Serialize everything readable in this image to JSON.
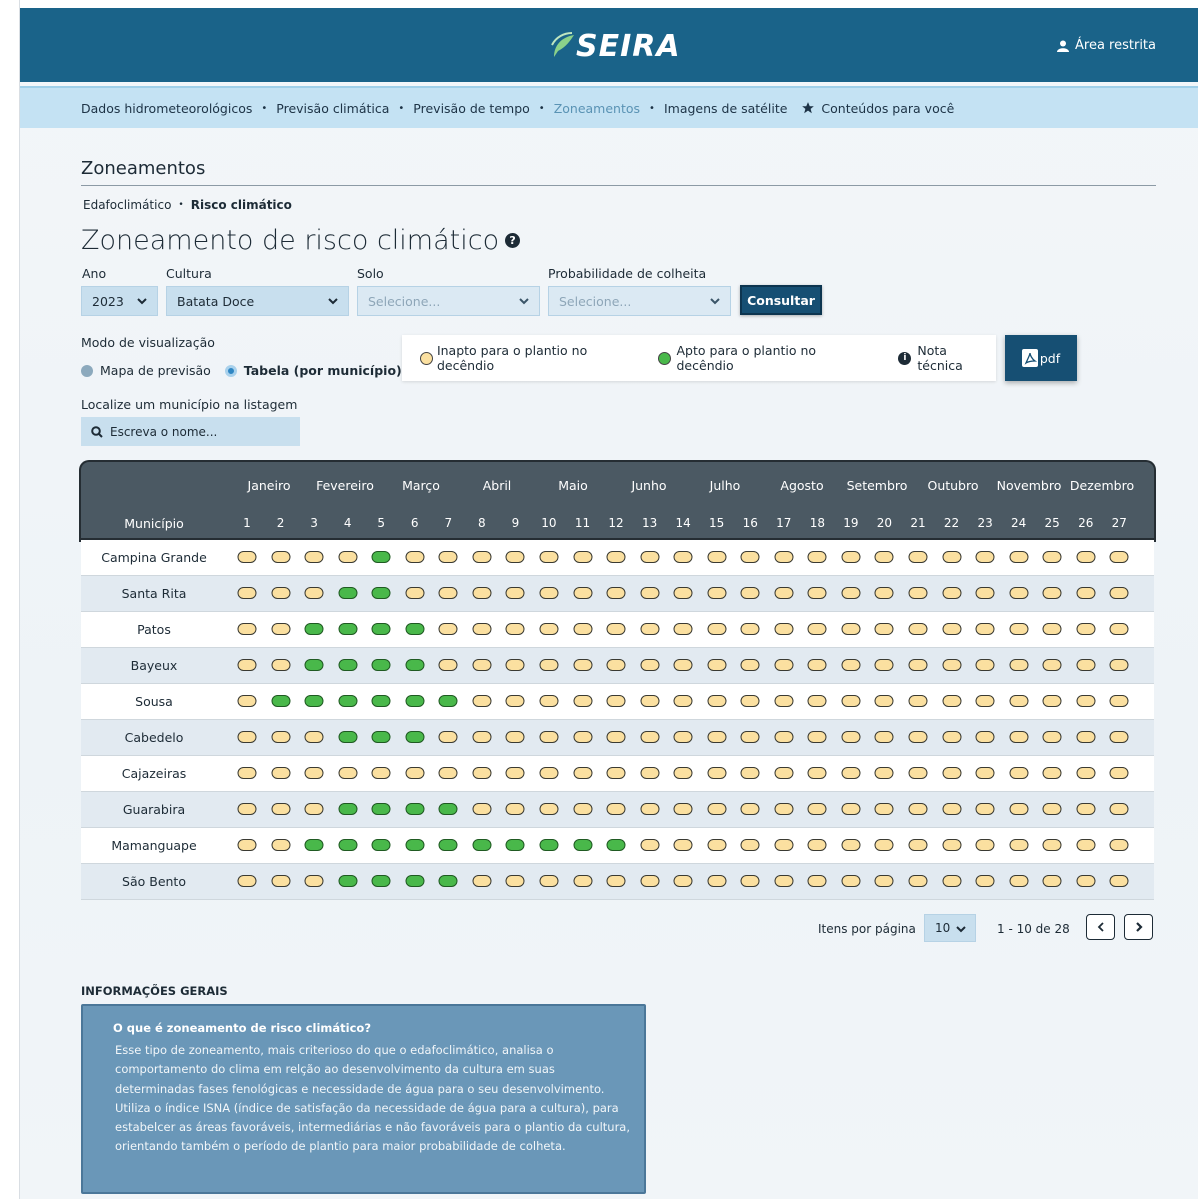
{
  "header": {
    "logo_text": "SEIRA",
    "login_label": "Área restrita"
  },
  "nav": {
    "items": [
      {
        "label": "Dados hidrometeorológicos",
        "active": false
      },
      {
        "label": "Previsão climática",
        "active": false
      },
      {
        "label": "Previsão de tempo",
        "active": false
      },
      {
        "label": "Zoneamentos",
        "active": true
      },
      {
        "label": "Imagens de satélite",
        "active": false
      },
      {
        "label": "Conteúdos para você",
        "active": false,
        "icon": "star-icon"
      }
    ]
  },
  "section_title": "Zoneamentos",
  "breadcrumb": {
    "first": "Edafoclimático",
    "current": "Risco climático"
  },
  "page_title": "Zoneamento de risco climático",
  "filters": {
    "ano_label": "Ano",
    "ano_value": "2023",
    "cultura_label": "Cultura",
    "cultura_value": "Batata Doce",
    "solo_label": "Solo",
    "solo_placeholder": "Selecione...",
    "prob_label": "Probabilidade de colheita",
    "prob_placeholder": "Selecione...",
    "consultar_label": "Consultar"
  },
  "view_mode": {
    "label": "Modo de visualização",
    "option_map": "Mapa de previsão",
    "option_table": "Tabela (por município)",
    "selected": "table"
  },
  "legend": {
    "inapto": "Inapto para o plantio no decêndio",
    "apto": "Apto para o plantio no decêndio",
    "nota": "Nota técnica",
    "colors": {
      "inapto": "#fbe0a0",
      "apto": "#49b84a"
    }
  },
  "pdf_label": "pdf",
  "search": {
    "label": "Localize um município na listagem",
    "placeholder": "Escreva  o nome..."
  },
  "table": {
    "municipio_header": "Município",
    "months": [
      "Janeiro",
      "Fevereiro",
      "Março",
      "Abril",
      "Maio",
      "Junho",
      "Julho",
      "Agosto",
      "Setembro",
      "Outubro",
      "Novembro",
      "Dezembro"
    ],
    "decendios": [
      "1",
      "2",
      "3",
      "4",
      "5",
      "6",
      "7",
      "8",
      "9",
      "10",
      "11",
      "12",
      "13",
      "14",
      "15",
      "16",
      "17",
      "18",
      "19",
      "20",
      "21",
      "22",
      "23",
      "24",
      "25",
      "26",
      "27"
    ],
    "rows": [
      {
        "name": "Campina Grande",
        "apto": [
          5
        ]
      },
      {
        "name": "Santa Rita",
        "apto": [
          4,
          5
        ]
      },
      {
        "name": "Patos",
        "apto": [
          3,
          4,
          5,
          6
        ]
      },
      {
        "name": "Bayeux",
        "apto": [
          3,
          4,
          5,
          6
        ]
      },
      {
        "name": "Sousa",
        "apto": [
          2,
          3,
          4,
          5,
          6,
          7
        ]
      },
      {
        "name": "Cabedelo",
        "apto": [
          4,
          5,
          6
        ]
      },
      {
        "name": "Cajazeiras",
        "apto": []
      },
      {
        "name": "Guarabira",
        "apto": [
          4,
          5,
          6,
          7
        ]
      },
      {
        "name": "Mamanguape",
        "apto": [
          3,
          4,
          5,
          6,
          7,
          8,
          9,
          10,
          11,
          12
        ]
      },
      {
        "name": "São Bento",
        "apto": [
          4,
          5,
          6,
          7
        ]
      }
    ]
  },
  "pagination": {
    "label": "Itens por página",
    "per_page": "10",
    "range": "1 - 10 de 28"
  },
  "info": {
    "title": "INFORMAÇÕES GERAIS",
    "question": "O que é zoneamento de risco climático?",
    "answer": "Esse tipo de zoneamento, mais criterioso do que o edafoclimático, analisa o comportamento do clima em relção ao desenvolvimento da cultura em suas determinadas fases fenológicas e necessidade de água para o seu desenvolvimento. Utiliza o índice ISNA (índice de satisfação da necessidade de água para a cultura), para estabelcer as áreas favoráveis, intermediárias e não favoráveis para o plantio da cultura, orientando também o período de plantio para maior probabilidade de colheta."
  }
}
